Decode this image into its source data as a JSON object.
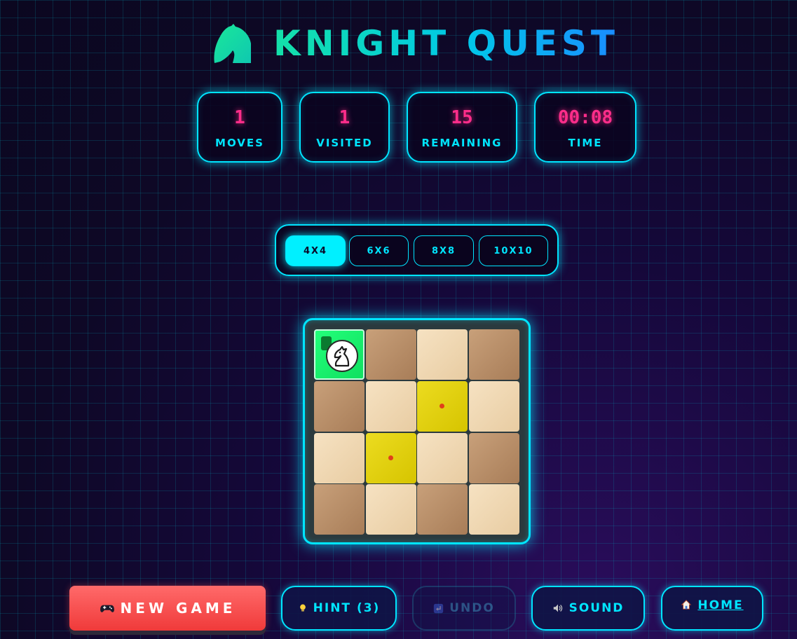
{
  "header": {
    "title": "KNIGHT QUEST",
    "icon": "knight-icon",
    "title_colors": [
      "#14e0a8",
      "#1a8cff"
    ]
  },
  "stats": [
    {
      "value": "1",
      "label": "MOVES"
    },
    {
      "value": "1",
      "label": "VISITED"
    },
    {
      "value": "15",
      "label": "REMAINING"
    },
    {
      "value": "00:08",
      "label": "TIME"
    }
  ],
  "board_sizes": [
    {
      "label": "4X4",
      "active": true
    },
    {
      "label": "6X6",
      "active": false
    },
    {
      "label": "8X8",
      "active": false
    },
    {
      "label": "10X10",
      "active": false
    }
  ],
  "board": {
    "size": 4,
    "current_cell": {
      "row": 0,
      "col": 0,
      "move_number": "1"
    },
    "valid_moves": [
      {
        "row": 1,
        "col": 2
      },
      {
        "row": 2,
        "col": 1
      }
    ]
  },
  "controls": {
    "new_game": {
      "icon": "gamepad-icon",
      "label": "NEW GAME"
    },
    "hint": {
      "icon": "lightbulb-icon",
      "label": "HINT (3)"
    },
    "undo": {
      "icon": "undo-icon",
      "label": "UNDO",
      "disabled": true
    },
    "sound": {
      "icon": "speaker-icon",
      "label": "SOUND"
    },
    "home": {
      "icon": "house-icon",
      "label": "HOME"
    }
  },
  "colors": {
    "accent": "#00e5ff",
    "stat_value": "#ff2d8a",
    "current_cell": "#22ff7a",
    "hint_cell": "#e2d010",
    "new_game_button": "#f54848"
  }
}
